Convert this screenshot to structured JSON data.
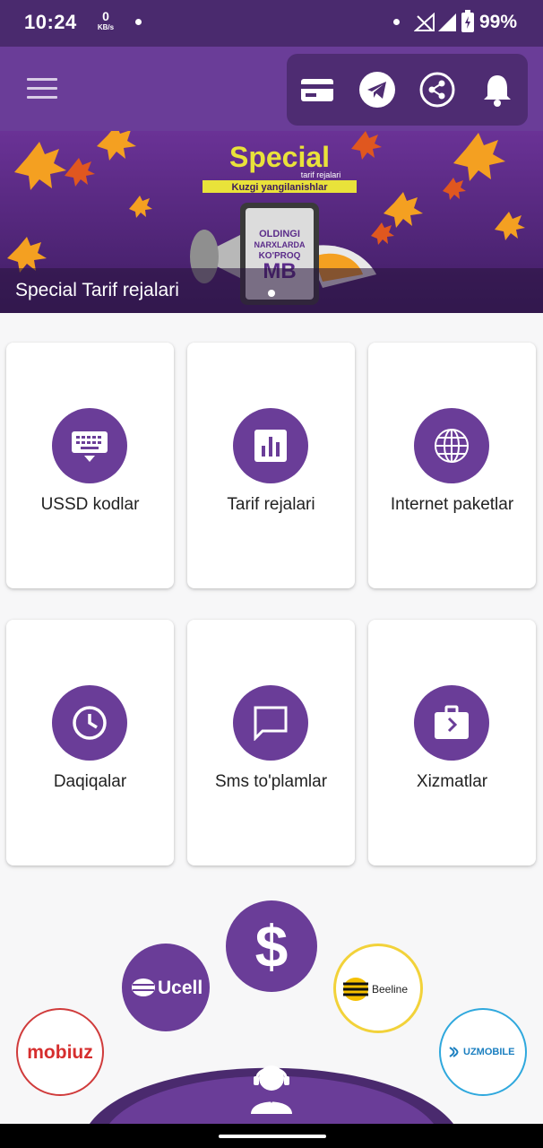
{
  "status_bar": {
    "time": "10:24",
    "net_speed_value": "0",
    "net_speed_unit": "KB/s",
    "battery": "99%"
  },
  "app_bar": {
    "menu_icon": "hamburger-menu-icon",
    "actions": [
      "card-icon",
      "telegram-icon",
      "share-icon",
      "bell-icon"
    ]
  },
  "banner": {
    "title": "Special Tarif rejalari",
    "art_heading": "Special",
    "art_sub": "tarif rejalari",
    "art_strip": "Kuzgi yangilanishlar",
    "art_screen": [
      "OLDINGI",
      "NARXLARDA",
      "KO'PROQ",
      "MB"
    ]
  },
  "menu": [
    {
      "label": "USSD kodlar",
      "icon": "keyboard-icon"
    },
    {
      "label": "Tarif rejalari",
      "icon": "bar-chart-icon"
    },
    {
      "label": "Internet paketlar",
      "icon": "globe-icon"
    },
    {
      "label": "Daqiqalar",
      "icon": "clock-icon"
    },
    {
      "label": "Sms to'plamlar",
      "icon": "chat-icon"
    },
    {
      "label": "Xizmatlar",
      "icon": "briefcase-icon"
    }
  ],
  "operators": {
    "ucell": "Ucell",
    "beeline": "Beeline",
    "mobiuz": "mobiuz",
    "uzmobile": "UZMOBILE"
  },
  "dollar_symbol": "$",
  "colors": {
    "primary": "#6a3d98",
    "dark": "#4a2a6e",
    "background": "#f7f7f8"
  }
}
